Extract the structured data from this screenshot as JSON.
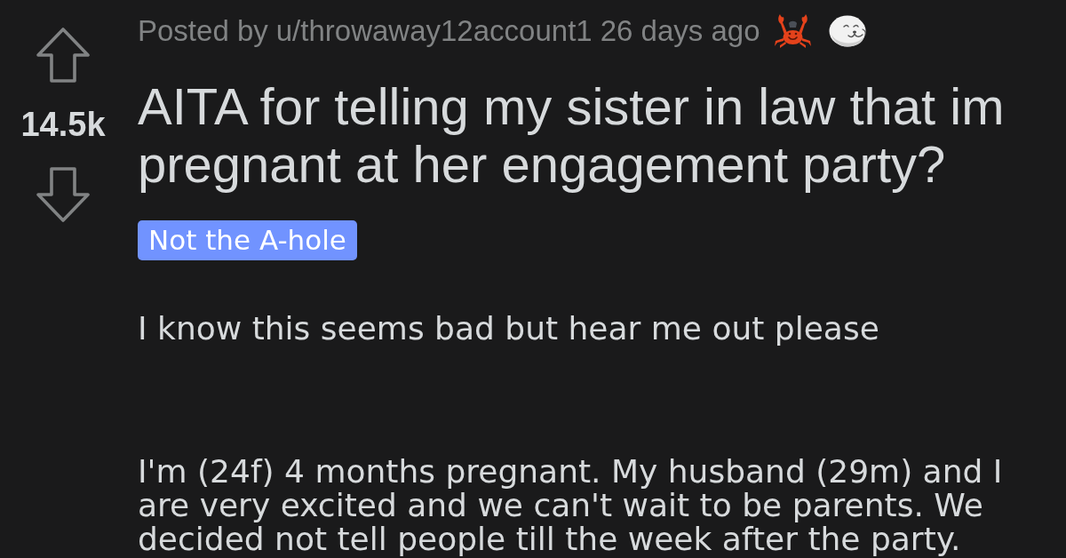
{
  "vote": {
    "count": "14.5k"
  },
  "post": {
    "meta": {
      "prefix": "Posted by",
      "author": "u/throwaway12account1",
      "time": "26 days ago"
    },
    "title": "AITA for telling my sister in law that im pregnant at her engagement party?",
    "flair": "Not the A-hole",
    "body": [
      "I know this seems bad but hear me out please",
      "I'm (24f) 4 months pregnant. My husband (29m) and I are very excited and we can't wait to be parents. We decided not tell people till the week after the party."
    ]
  }
}
